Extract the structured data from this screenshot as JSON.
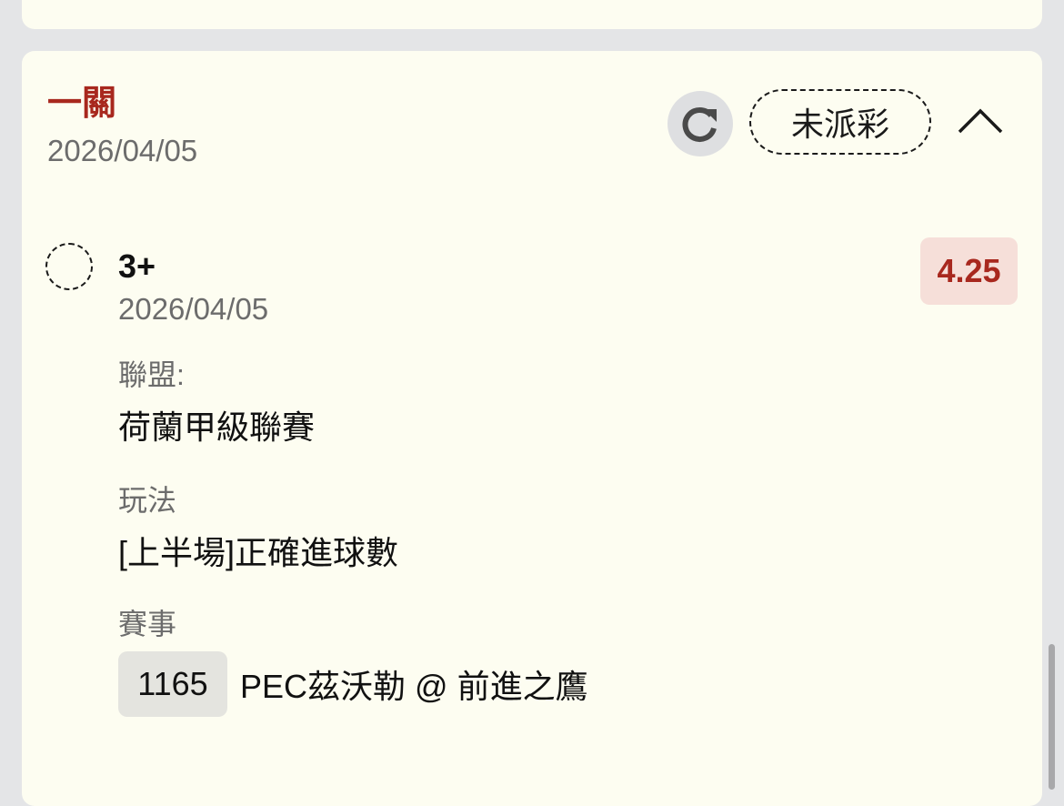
{
  "bet": {
    "type_label": "一關",
    "date": "2026/04/05",
    "status": "未派彩",
    "refresh_icon": "refresh-icon",
    "collapse_icon": "chevron-up-icon"
  },
  "selection": {
    "name": "3+",
    "date": "2026/04/05",
    "odds": "4.25",
    "league_label": "聯盟:",
    "league_value": "荷蘭甲級聯賽",
    "bet_type_label": "玩法",
    "bet_type_value": "[上半場]正確進球數",
    "match_label": "賽事",
    "match_number": "1165",
    "match_name": "PEC茲沃勒 @ 前進之鷹"
  },
  "colors": {
    "accent": "#a8281e",
    "odds_bg": "#f6dfd9",
    "card_bg": "#fdfdf1",
    "page_bg": "#e4e5e7"
  }
}
